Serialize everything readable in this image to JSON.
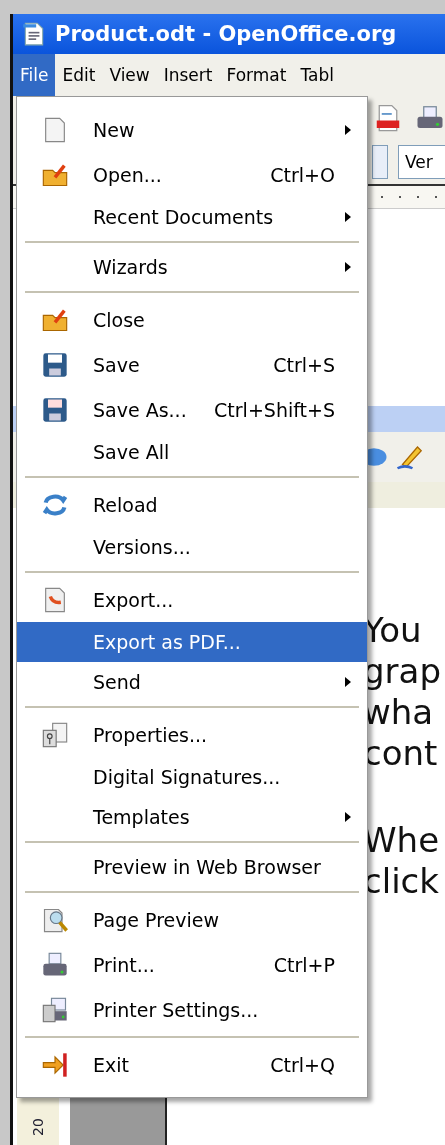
{
  "window": {
    "title": "Product.odt - OpenOffice.org"
  },
  "menubar": [
    {
      "label": "File",
      "selected": true
    },
    {
      "label": "Edit",
      "selected": false
    },
    {
      "label": "View",
      "selected": false
    },
    {
      "label": "Insert",
      "selected": false
    },
    {
      "label": "Format",
      "selected": false
    },
    {
      "label": "Tabl",
      "selected": false
    }
  ],
  "font_field": {
    "value": "Ver"
  },
  "file_menu": [
    {
      "kind": "item",
      "label": "New",
      "has_icon": true,
      "submenu": true,
      "selected": false
    },
    {
      "kind": "item",
      "label": "Open...",
      "shortcut": "Ctrl+O",
      "has_icon": true,
      "submenu": false,
      "selected": false
    },
    {
      "kind": "item",
      "label": "Recent Documents",
      "has_icon": false,
      "submenu": true,
      "selected": false
    },
    {
      "kind": "separator"
    },
    {
      "kind": "item",
      "label": "Wizards",
      "has_icon": false,
      "submenu": true,
      "selected": false
    },
    {
      "kind": "separator"
    },
    {
      "kind": "item",
      "label": "Close",
      "has_icon": true,
      "submenu": false,
      "selected": false
    },
    {
      "kind": "item",
      "label": "Save",
      "shortcut": "Ctrl+S",
      "has_icon": true,
      "submenu": false,
      "selected": false
    },
    {
      "kind": "item",
      "label": "Save As...",
      "shortcut": "Ctrl+Shift+S",
      "has_icon": true,
      "submenu": false,
      "selected": false
    },
    {
      "kind": "item",
      "label": "Save All",
      "has_icon": false,
      "submenu": false,
      "selected": false
    },
    {
      "kind": "separator"
    },
    {
      "kind": "item",
      "label": "Reload",
      "has_icon": true,
      "submenu": false,
      "selected": false
    },
    {
      "kind": "item",
      "label": "Versions...",
      "has_icon": false,
      "submenu": false,
      "selected": false
    },
    {
      "kind": "separator"
    },
    {
      "kind": "item",
      "label": "Export...",
      "has_icon": true,
      "submenu": false,
      "selected": false
    },
    {
      "kind": "item",
      "label": "Export as PDF...",
      "has_icon": false,
      "submenu": false,
      "selected": true
    },
    {
      "kind": "item",
      "label": "Send",
      "has_icon": false,
      "submenu": true,
      "selected": false
    },
    {
      "kind": "separator"
    },
    {
      "kind": "item",
      "label": "Properties...",
      "has_icon": true,
      "submenu": false,
      "selected": false
    },
    {
      "kind": "item",
      "label": "Digital Signatures...",
      "has_icon": false,
      "submenu": false,
      "selected": false
    },
    {
      "kind": "item",
      "label": "Templates",
      "has_icon": false,
      "submenu": true,
      "selected": false
    },
    {
      "kind": "separator"
    },
    {
      "kind": "item",
      "label": "Preview in Web Browser",
      "has_icon": false,
      "submenu": false,
      "selected": false
    },
    {
      "kind": "separator"
    },
    {
      "kind": "item",
      "label": "Page Preview",
      "has_icon": true,
      "submenu": false,
      "selected": false
    },
    {
      "kind": "item",
      "label": "Print...",
      "shortcut": "Ctrl+P",
      "has_icon": true,
      "submenu": false,
      "selected": false
    },
    {
      "kind": "item",
      "label": "Printer Settings...",
      "has_icon": true,
      "submenu": false,
      "selected": false
    },
    {
      "kind": "separator"
    },
    {
      "kind": "item",
      "label": "Exit",
      "shortcut": "Ctrl+Q",
      "has_icon": true,
      "submenu": false,
      "selected": false
    }
  ],
  "document": {
    "lines": [
      "You",
      "grap",
      "wha",
      "cont"
    ],
    "lines_2": [
      "Whe",
      "click"
    ]
  },
  "ruler": {
    "label": "20"
  }
}
